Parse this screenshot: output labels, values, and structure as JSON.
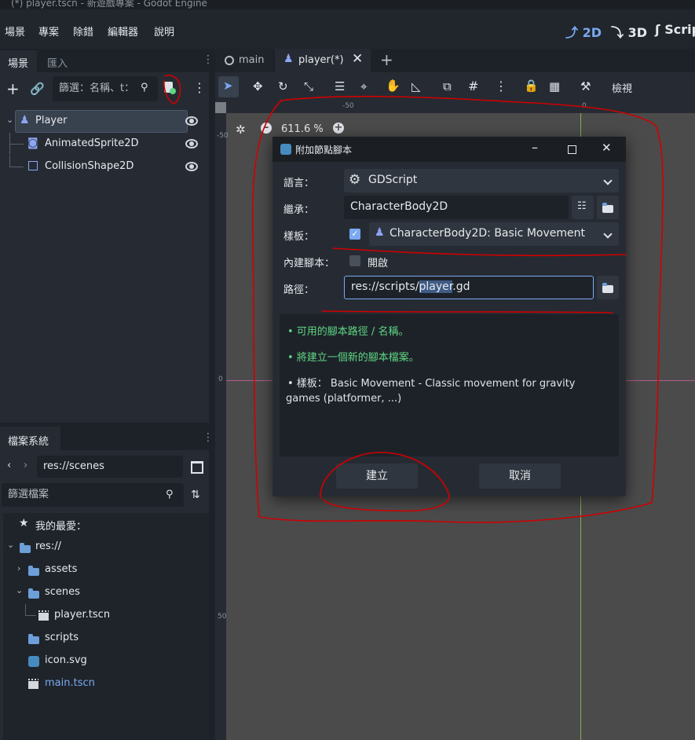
{
  "window": {
    "title": "(*) player.tscn - 新遊戲專案 - Godot Engine"
  },
  "menu": [
    "場景",
    "專案",
    "除錯",
    "編輯器",
    "說明"
  ],
  "modes": {
    "m2d": "2D",
    "m3d": "3D",
    "script": "Script"
  },
  "scene_dock": {
    "tabs": [
      "場景",
      "匯入"
    ],
    "filter_placeholder": "篩選：名稱、t：",
    "nodes": [
      {
        "name": "Player",
        "type": "root",
        "selected": true
      },
      {
        "name": "AnimatedSprite2D",
        "type": "child"
      },
      {
        "name": "CollisionShape2D",
        "type": "child"
      }
    ]
  },
  "filesystem_dock": {
    "title": "檔案系統",
    "path": "res://scenes",
    "filter_placeholder": "篩選檔案",
    "favorites": "我的最愛：",
    "items": [
      {
        "name": "res://",
        "kind": "folder"
      },
      {
        "name": "assets",
        "kind": "folder"
      },
      {
        "name": "scenes",
        "kind": "folder"
      },
      {
        "name": "player.tscn",
        "kind": "scene"
      },
      {
        "name": "scripts",
        "kind": "folder"
      },
      {
        "name": "icon.svg",
        "kind": "image"
      },
      {
        "name": "main.tscn",
        "kind": "scene"
      }
    ]
  },
  "editor_tabs": [
    {
      "label": "main"
    },
    {
      "label": "player(*)"
    }
  ],
  "toolbar": {
    "view_label": "檢視"
  },
  "viewport": {
    "zoom": "611.6 %",
    "ruler_top": [
      "-50",
      "0"
    ],
    "ruler_left": [
      "-50",
      "0",
      "50"
    ]
  },
  "dialog": {
    "title": "附加節點腳本",
    "language_label": "語言：",
    "language_value": "GDScript",
    "inherits_label": "繼承：",
    "inherits_value": "CharacterBody2D",
    "template_label": "樣板：",
    "template_value": "CharacterBody2D: Basic Movement",
    "builtin_label": "內建腳本：",
    "builtin_value": "開啟",
    "path_label": "路徑：",
    "path_prefix": "res://scripts/",
    "path_selected": "player",
    "path_suffix": ".gd",
    "messages": [
      {
        "text": "• 可用的腳本路徑 / 名稱。",
        "color": "#5fd783"
      },
      {
        "text": "• 將建立一個新的腳本檔案。",
        "color": "#5fd783"
      },
      {
        "text": "• 樣板： Basic Movement - Classic movement for gravity",
        "color": "#dfe3e8"
      },
      {
        "text": "games (platformer, ...)",
        "color": "#dfe3e8"
      }
    ],
    "create_label": "建立",
    "cancel_label": "取消"
  },
  "colors": {
    "accent": "#7aa9f0",
    "panel": "#262b33",
    "viewport": "#4b4b4b",
    "annotation": "#d00000"
  }
}
